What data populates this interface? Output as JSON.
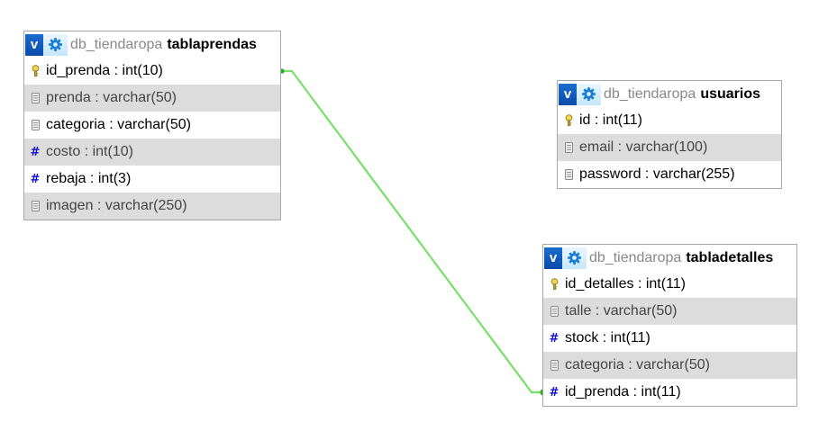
{
  "colors": {
    "relation_line": "#77e06a",
    "relation_dot": "#22aa22",
    "toggle_bg": "#0a58b8",
    "gear": "#1b7ed6",
    "alt_row": "#dcdcdc"
  },
  "tables": [
    {
      "db": "db_tiendaropa",
      "name": "tablaprendas",
      "toggle": "v",
      "columns": [
        {
          "text": "id_prenda : int(10)",
          "icon": "key-icon"
        },
        {
          "text": "prenda : varchar(50)",
          "icon": "text-field-icon"
        },
        {
          "text": "categoria : varchar(50)",
          "icon": "text-field-icon"
        },
        {
          "text": "costo : int(10)",
          "icon": "hash-icon"
        },
        {
          "text": "rebaja : int(3)",
          "icon": "hash-icon"
        },
        {
          "text": "imagen : varchar(250)",
          "icon": "text-field-icon"
        }
      ]
    },
    {
      "db": "db_tiendaropa",
      "name": "usuarios",
      "toggle": "v",
      "columns": [
        {
          "text": "id : int(11)",
          "icon": "key-icon"
        },
        {
          "text": "email : varchar(100)",
          "icon": "text-field-icon"
        },
        {
          "text": "password : varchar(255)",
          "icon": "text-field-icon"
        }
      ]
    },
    {
      "db": "db_tiendaropa",
      "name": "tabladetalles",
      "toggle": "v",
      "columns": [
        {
          "text": "id_detalles : int(11)",
          "icon": "key-icon"
        },
        {
          "text": "talle : varchar(50)",
          "icon": "text-field-icon"
        },
        {
          "text": "stock : int(11)",
          "icon": "hash-icon"
        },
        {
          "text": "categoria : varchar(50)",
          "icon": "text-field-icon"
        },
        {
          "text": "id_prenda : int(11)",
          "icon": "hash-icon"
        }
      ]
    }
  ],
  "relations": [
    {
      "from_table": 0,
      "from_column": 0,
      "to_table": 2,
      "to_column": 4
    }
  ]
}
